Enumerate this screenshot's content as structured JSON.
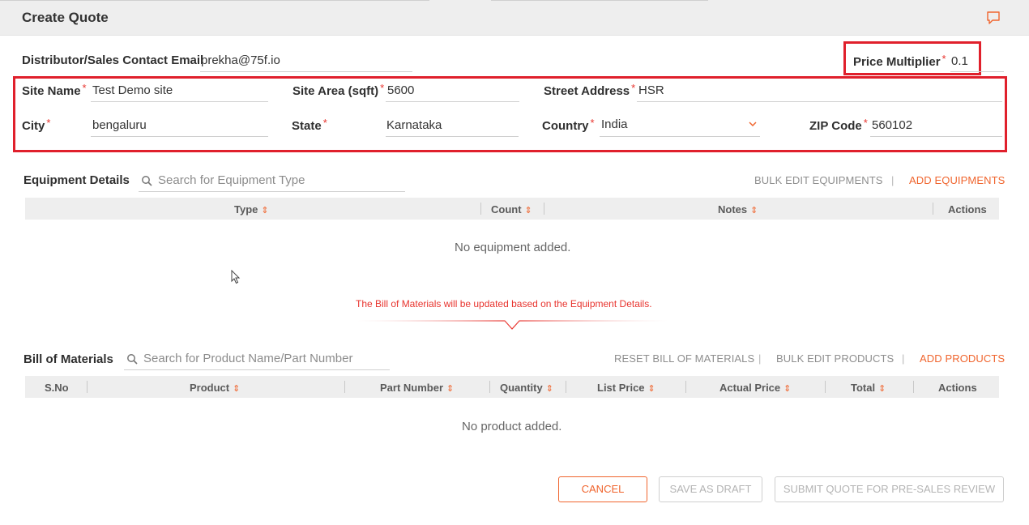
{
  "header": {
    "title": "Create Quote",
    "chat_icon": "comment-icon"
  },
  "form": {
    "email_label": "Distributor/Sales Contact Email",
    "email_value": "prekha@75f.io",
    "multiplier_label": "Price Multiplier",
    "multiplier_value": "0.1",
    "required_mark": "*",
    "site_name_label": "Site Name",
    "site_name_value": "Test Demo site",
    "site_area_label": "Site Area (sqft)",
    "site_area_value": "5600",
    "street_label": "Street Address",
    "street_value": "HSR",
    "city_label": "City",
    "city_value": "bengaluru",
    "state_label": "State",
    "state_value": "Karnataka",
    "country_label": "Country",
    "country_value": "India",
    "zip_label": "ZIP Code",
    "zip_value": "560102"
  },
  "equipment": {
    "title": "Equipment Details",
    "search_placeholder": "Search for Equipment Type",
    "bulk_edit": "BULK EDIT EQUIPMENTS",
    "separator": "|",
    "add": "ADD EQUIPMENTS",
    "columns": [
      "Type",
      "Count",
      "Notes",
      "Actions"
    ],
    "empty": "No equipment added."
  },
  "notice": "The Bill of Materials will be updated based on the Equipment Details.",
  "bom": {
    "title": "Bill of Materials",
    "search_placeholder": "Search for Product Name/Part Number",
    "reset": "RESET BILL OF MATERIALS",
    "bulk_edit": "BULK EDIT PRODUCTS",
    "separator": "|",
    "add": "ADD PRODUCTS",
    "columns": [
      "S.No",
      "Product",
      "Part Number",
      "Quantity",
      "List Price",
      "Actual Price",
      "Total",
      "Actions"
    ],
    "empty": "No product added."
  },
  "footer": {
    "cancel": "CANCEL",
    "save_draft": "SAVE AS DRAFT",
    "submit": "SUBMIT QUOTE FOR PRE-SALES REVIEW"
  },
  "colors": {
    "accent": "#f0652e",
    "required": "#e8342e",
    "highlight": "#e0202c"
  }
}
